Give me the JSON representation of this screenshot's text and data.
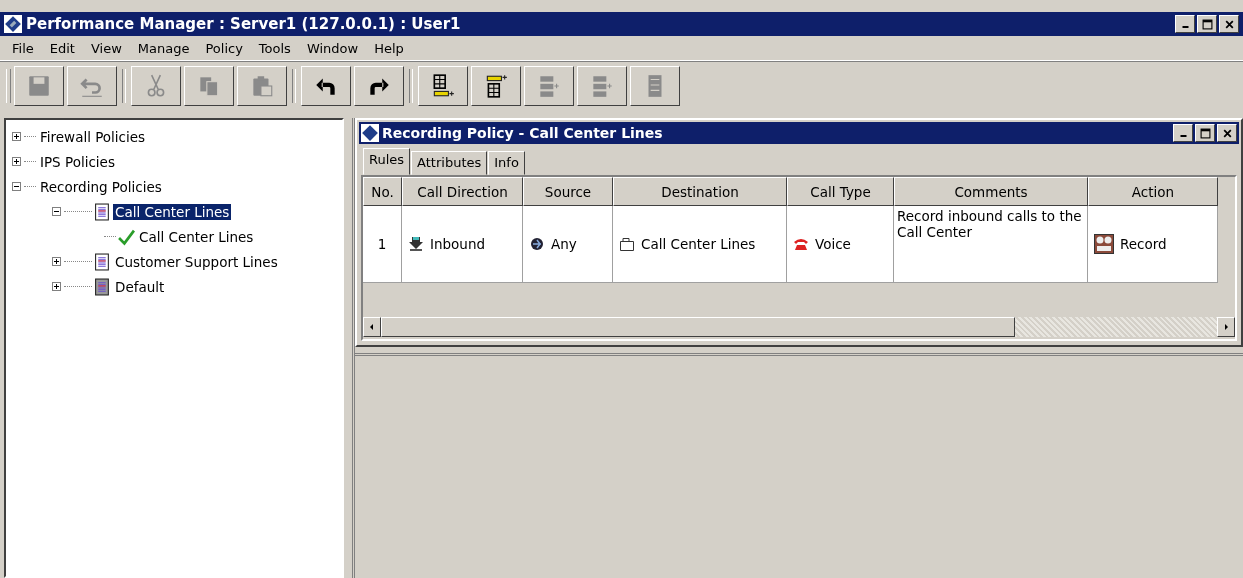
{
  "window": {
    "title": "Performance Manager : Server1 (127.0.0.1) : User1"
  },
  "menu": [
    "File",
    "Edit",
    "View",
    "Manage",
    "Policy",
    "Tools",
    "Window",
    "Help"
  ],
  "toolbar": [
    {
      "kind": "save",
      "disabled": true
    },
    {
      "kind": "undo",
      "disabled": true
    },
    {
      "kind": "sep"
    },
    {
      "kind": "cut",
      "disabled": true
    },
    {
      "kind": "copy",
      "disabled": true
    },
    {
      "kind": "paste",
      "disabled": true
    },
    {
      "kind": "sep"
    },
    {
      "kind": "back",
      "disabled": false
    },
    {
      "kind": "forward",
      "disabled": false
    },
    {
      "kind": "sep"
    },
    {
      "kind": "insert-below",
      "disabled": false
    },
    {
      "kind": "insert-above",
      "disabled": false
    },
    {
      "kind": "add-group",
      "disabled": true
    },
    {
      "kind": "add-subgroup",
      "disabled": true
    },
    {
      "kind": "delete",
      "disabled": true
    }
  ],
  "tree": [
    {
      "label": "Firewall Policies",
      "expanded": false,
      "selected": false
    },
    {
      "label": "IPS Policies",
      "expanded": false,
      "selected": false
    },
    {
      "label": "Recording Policies",
      "expanded": true,
      "selected": false,
      "children": [
        {
          "label": "Call Center Lines",
          "kind": "policy",
          "expanded": true,
          "selected": true,
          "children": [
            {
              "label": "Call Center Lines",
              "kind": "rule",
              "selected": false
            }
          ]
        },
        {
          "label": "Customer Support Lines",
          "kind": "policy",
          "expanded": false,
          "selected": false
        },
        {
          "label": "Default",
          "kind": "default",
          "expanded": false,
          "selected": false
        }
      ]
    }
  ],
  "child_window": {
    "title": "Recording Policy - Call Center Lines",
    "tabs": [
      {
        "label": "Rules",
        "selected": true
      },
      {
        "label": "Attributes",
        "selected": false
      },
      {
        "label": "Info",
        "selected": false
      }
    ],
    "table": {
      "columns": [
        "No.",
        "Call Direction",
        "Source",
        "Destination",
        "Call Type",
        "Comments",
        "Action"
      ],
      "rows": [
        {
          "cells": [
            {
              "text": "1",
              "kind": "number"
            },
            {
              "text": "Inbound",
              "kind": "inbound"
            },
            {
              "text": "Any",
              "kind": "any"
            },
            {
              "text": "Call Center Lines",
              "kind": "lines"
            },
            {
              "text": "Voice",
              "kind": "phone"
            },
            {
              "text": "Record inbound calls to the Call Center",
              "kind": "comment"
            },
            {
              "text": "Record",
              "kind": "recorder"
            }
          ]
        }
      ]
    }
  }
}
